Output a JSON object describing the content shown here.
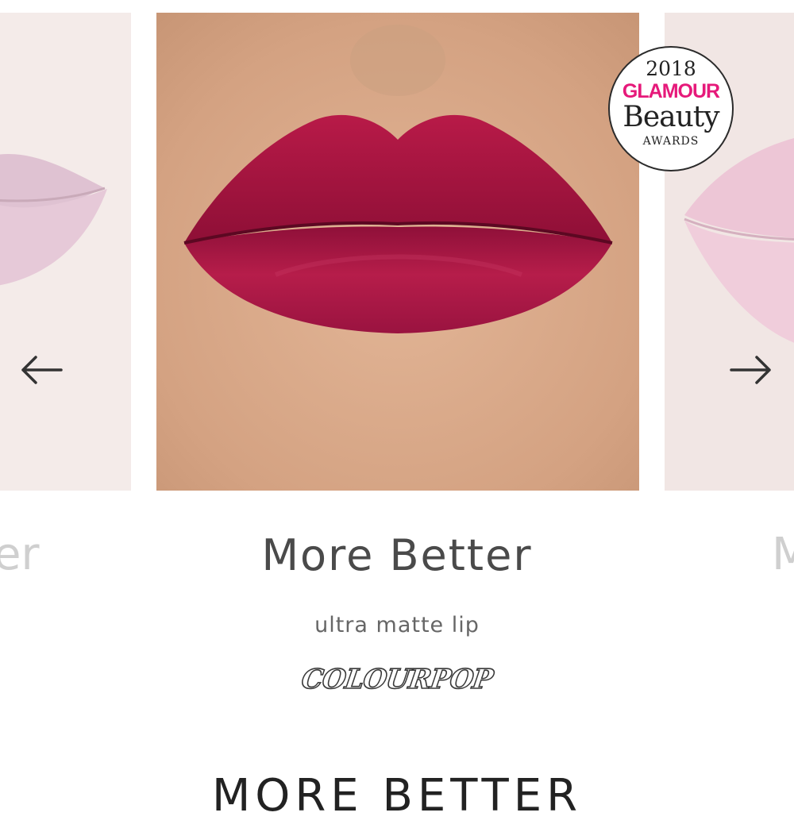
{
  "award_badge": {
    "year": "2018",
    "magazine": "GLAMOUR",
    "title": "Beauty",
    "subtitle": "AWARDS"
  },
  "carousel": {
    "prev_icon": "arrow-left-icon",
    "next_icon": "arrow-right-icon",
    "prev_name_fragment": "er",
    "next_name_fragment": "M"
  },
  "product": {
    "name": "More Better",
    "type": "ultra matte lip",
    "brand": "COLOURPOP",
    "shade_color": "#a3123f"
  },
  "section": {
    "heading": "MORE BETTER"
  }
}
